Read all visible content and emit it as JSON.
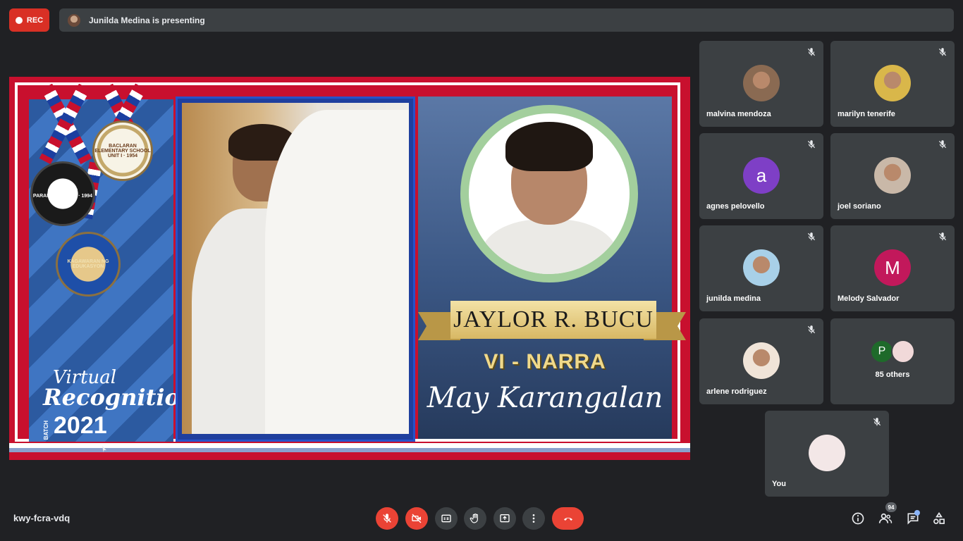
{
  "recording": {
    "label": "REC"
  },
  "presenting_banner": {
    "text": "Junilda Medina is presenting"
  },
  "slide": {
    "name_banner": "JAYLOR R. BUCU",
    "section": "VI - NARRA",
    "honor": "May Karangalan",
    "event_line1": "Virtual",
    "event_line2": "Recognition",
    "batch_label": "BATCH",
    "year": "2021",
    "medals": {
      "division": "DIVISION OF PARAÑAQUE CITY · 1994",
      "school": "BACLARAN ELEMENTARY SCHOOL UNIT I · 1954",
      "deped": "KAGAWARAN NG EDUKASYON"
    }
  },
  "participants": [
    {
      "name": "malvina mendoza",
      "avatar_type": "photo",
      "muted": true
    },
    {
      "name": "marilyn tenerife",
      "avatar_type": "photo",
      "muted": true
    },
    {
      "name": "agnes pelovello",
      "avatar_type": "initial",
      "initial": "a",
      "color": "#7e3fc6",
      "muted": true
    },
    {
      "name": "joel soriano",
      "avatar_type": "photo",
      "muted": true
    },
    {
      "name": "junilda medina",
      "avatar_type": "photo",
      "muted": true
    },
    {
      "name": "Melody Salvador",
      "avatar_type": "initial",
      "initial": "M",
      "color": "#c2185b",
      "muted": true
    },
    {
      "name": "arlene rodriguez",
      "avatar_type": "photo",
      "muted": true
    }
  ],
  "others": {
    "label": "85 others",
    "initial": "P",
    "initial_color": "#1e6a2a"
  },
  "self_tile": {
    "name": "You",
    "muted": true
  },
  "meeting": {
    "code": "kwy-fcra-vdq"
  },
  "controls": [
    "mic-off",
    "camera-off",
    "captions",
    "raise-hand",
    "present",
    "more",
    "leave-call"
  ],
  "right_controls": {
    "people_count": "94"
  },
  "colors": {
    "background": "#202124",
    "tile": "#3c4043",
    "danger": "#ea4335",
    "accent": "#8ab4f8"
  }
}
